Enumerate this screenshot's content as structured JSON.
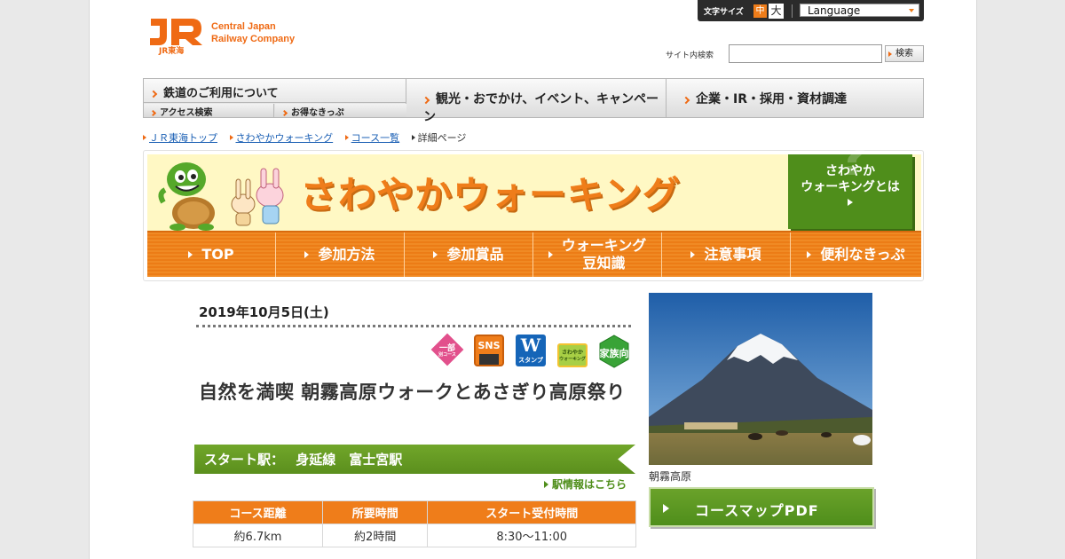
{
  "util": {
    "font_size_label": "文字サイズ",
    "font_size_mid": "中",
    "font_size_large": "大",
    "language": "Language"
  },
  "logo": {
    "jr_text": "JR東海",
    "en_line1": "Central Japan",
    "en_line2": "Railway Company"
  },
  "search": {
    "label": "サイト内検索",
    "value": "",
    "button": "検索"
  },
  "gnav": {
    "rail": "鉄道のご利用について",
    "access": "アクセス検索",
    "tickets": "お得なきっぷ",
    "tourism": "観光・おでかけ、イベント、キャンペーン",
    "corporate": "企業・IR・採用・資材調達"
  },
  "breadcrumb": [
    {
      "label": "ＪＲ東海トップ"
    },
    {
      "label": "さわやかウォーキング"
    },
    {
      "label": "コース一覧"
    },
    {
      "label": "詳細ページ"
    }
  ],
  "banner": {
    "title": "さわやかウォーキング",
    "about": "さわやか",
    "about2": "ウォーキングとは"
  },
  "tabs": [
    {
      "label": "TOP"
    },
    {
      "label": "参加方法"
    },
    {
      "label": "参加賞品"
    },
    {
      "label": "ウォーキング",
      "label2": "豆知識"
    },
    {
      "label": "注意事項"
    },
    {
      "label": "便利なきっぷ"
    }
  ],
  "event": {
    "date": "2019年10月5日(土)",
    "badges": {
      "partial": "一部",
      "partial2": "別コース",
      "sns": "SNS",
      "w": "W",
      "w2": "スタンプ",
      "home": "さわやか",
      "home2": "ウォーキング",
      "family": "家族向"
    },
    "title": "自然を満喫 朝霧高原ウォークとあさぎり高原祭り",
    "start_label": "スタート駅：",
    "start_station": "身延線　富士宮駅",
    "station_link": "駅情報はこちら",
    "table_headers": [
      "コース距離",
      "所要時間",
      "スタート受付時間"
    ],
    "table_values": [
      "約6.7km",
      "約2時間",
      "8:30～11:00"
    ]
  },
  "photo": {
    "caption": "朝霧高原"
  },
  "pdf_button": "コースマップPDF",
  "colors": {
    "orange": "#ef7d1a",
    "green": "#4f8e1b",
    "jr_orange": "#ef6a14"
  }
}
